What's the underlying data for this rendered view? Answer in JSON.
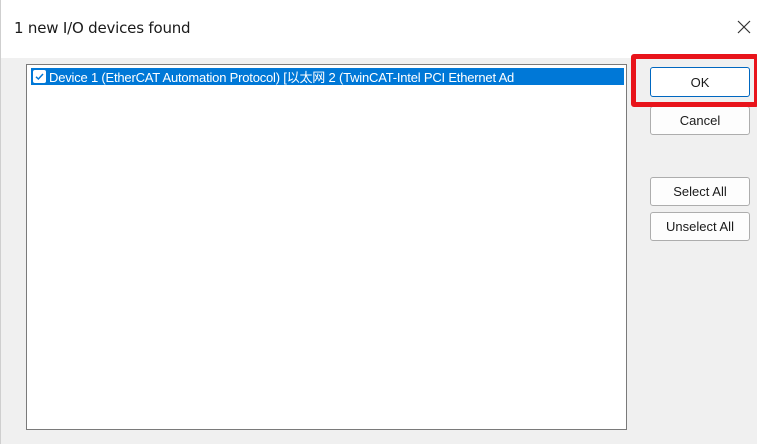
{
  "dialog": {
    "title": "1 new I/O devices found",
    "close_icon": "close-icon"
  },
  "device_list": {
    "items": [
      {
        "checked": true,
        "selected": true,
        "label": "Device 1 (EtherCAT Automation Protocol)     [以太网 2 (TwinCAT-Intel PCI Ethernet Ad"
      }
    ]
  },
  "buttons": {
    "ok": "OK",
    "cancel": "Cancel",
    "select_all": "Select All",
    "unselect_all": "Unselect All"
  },
  "colors": {
    "selection": "#0078d7",
    "highlight_box": "#e8141b",
    "default_button_border": "#0067c0"
  }
}
